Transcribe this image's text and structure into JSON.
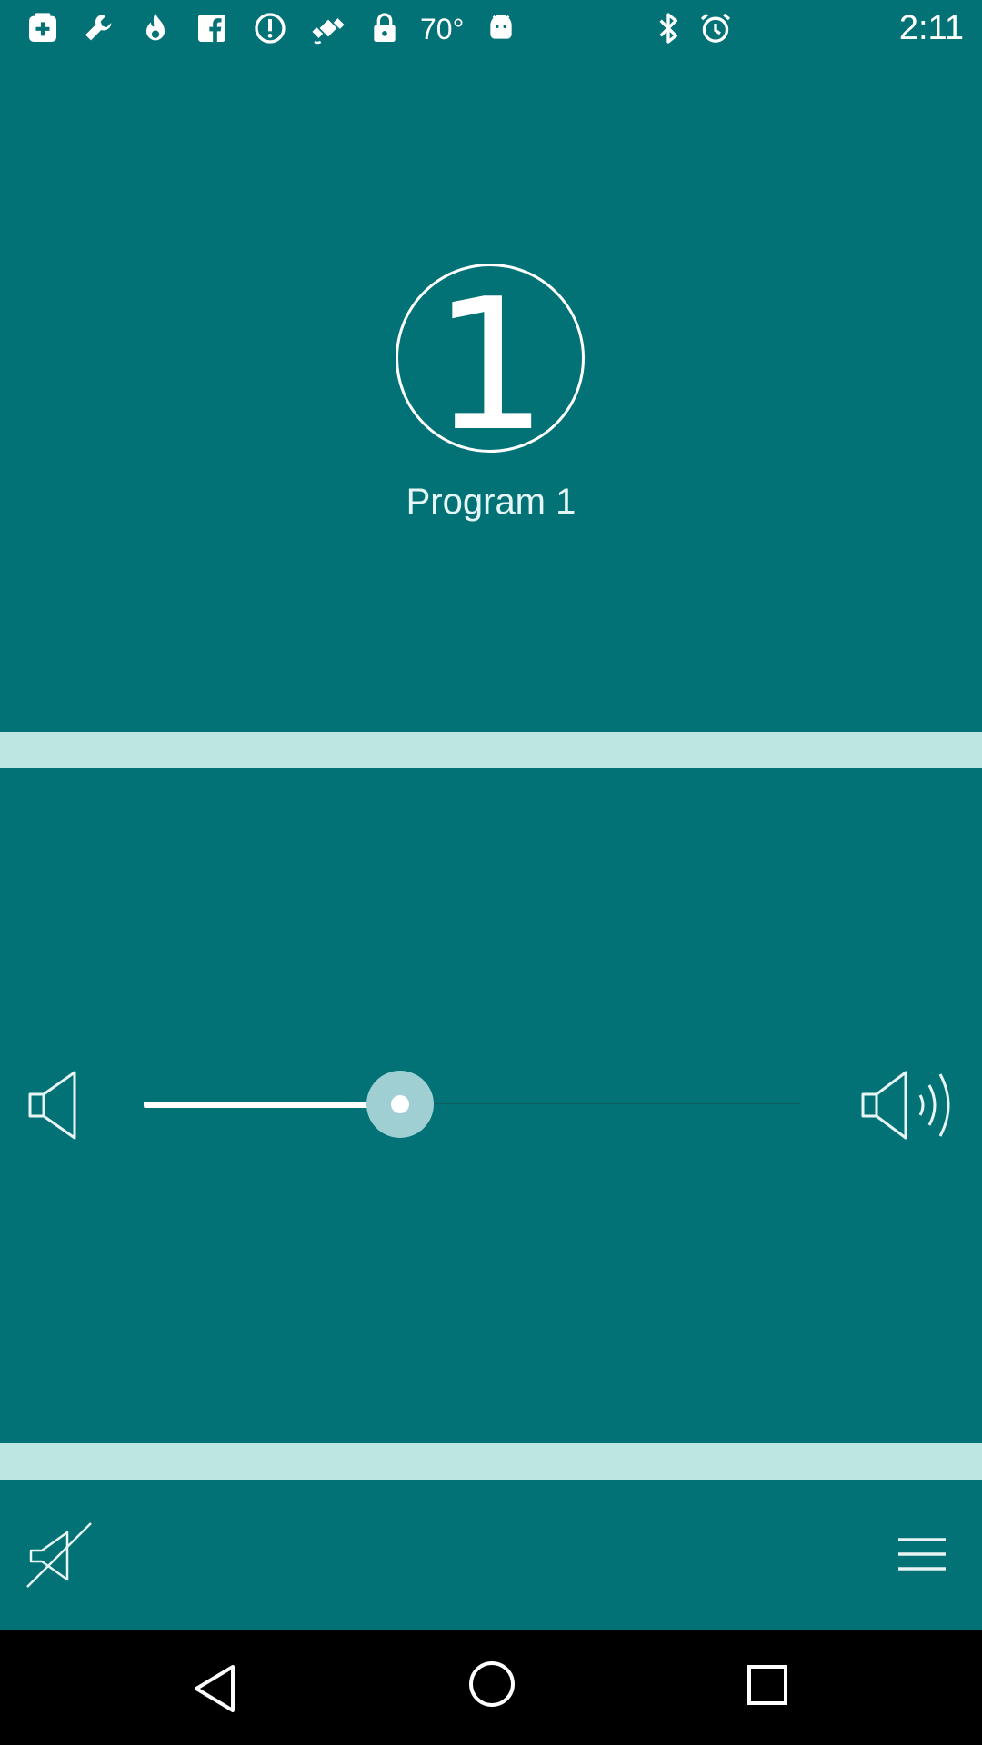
{
  "status_bar": {
    "icons": [
      "medical-kit-icon",
      "wrench-icon",
      "flame-icon",
      "facebook-icon",
      "alert-circle-icon",
      "fake-gps-icon",
      "lock-icon",
      "weather-temperature",
      "android-debug-icon",
      "bluetooth-icon",
      "alarm-icon"
    ],
    "temperature": "70°",
    "time": "2:11"
  },
  "program": {
    "number": "1",
    "name": "Program 1"
  },
  "volume": {
    "level_fraction": 0.39,
    "min_icon": "speaker-low-icon",
    "max_icon": "speaker-high-icon"
  },
  "bottom_bar": {
    "left_icon": "mute-icon",
    "right_icon": "menu-icon"
  },
  "nav_bar": {
    "icons": [
      "back-icon",
      "home-icon",
      "recents-icon"
    ]
  },
  "colors": {
    "background": "#037277",
    "separator": "#bde5e2",
    "slider_thumb": "#9fcfd3",
    "nav": "#000000"
  }
}
